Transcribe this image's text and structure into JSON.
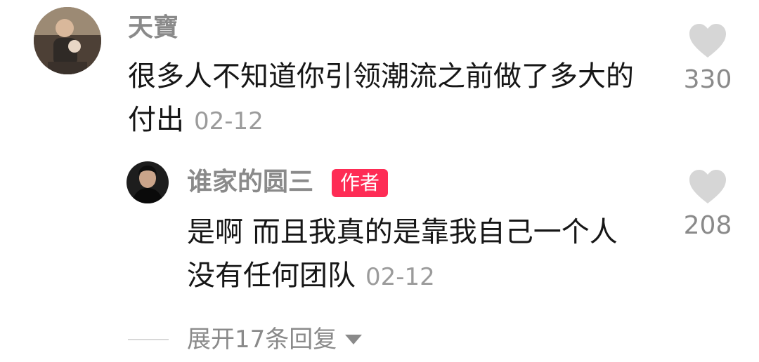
{
  "comment": {
    "username": "天寶",
    "text": "很多人不知道你引领潮流之前做了多大的付出",
    "date": "02-12",
    "like_count": "330",
    "avatar_icon": "user-avatar-photo"
  },
  "reply": {
    "username": "谁家的圆三",
    "badge": "作者",
    "badge_color": "#fe2c55",
    "text": "是啊 而且我真的是靠我自己一个人 没有任何团队",
    "date": "02-12",
    "like_count": "208",
    "avatar_icon": "author-avatar-photo"
  },
  "expand": {
    "label": "展开17条回复",
    "icon": "chevron-down-icon"
  },
  "icons": {
    "like": "heart-icon"
  }
}
